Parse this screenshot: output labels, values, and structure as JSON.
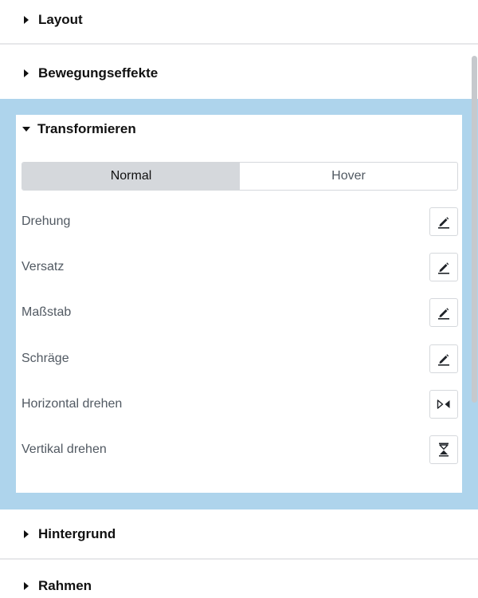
{
  "sections": {
    "layout": "Layout",
    "motion": "Bewegungseffekte",
    "transform": "Transformieren",
    "background": "Hintergrund",
    "border": "Rahmen"
  },
  "transform_panel": {
    "tabs": [
      "Normal",
      "Hover"
    ],
    "active_tab": "Normal",
    "rows": [
      {
        "label": "Drehung",
        "icon": "pencil-icon"
      },
      {
        "label": "Versatz",
        "icon": "pencil-icon"
      },
      {
        "label": "Maßstab",
        "icon": "pencil-icon"
      },
      {
        "label": "Schräge",
        "icon": "pencil-icon"
      },
      {
        "label": "Horizontal drehen",
        "icon": "flip-horizontal-icon"
      },
      {
        "label": "Vertikal drehen",
        "icon": "flip-vertical-icon"
      }
    ]
  },
  "colors": {
    "highlight": "#aed4ec",
    "active_tab": "#d5d8dc",
    "label_text": "#515962"
  }
}
